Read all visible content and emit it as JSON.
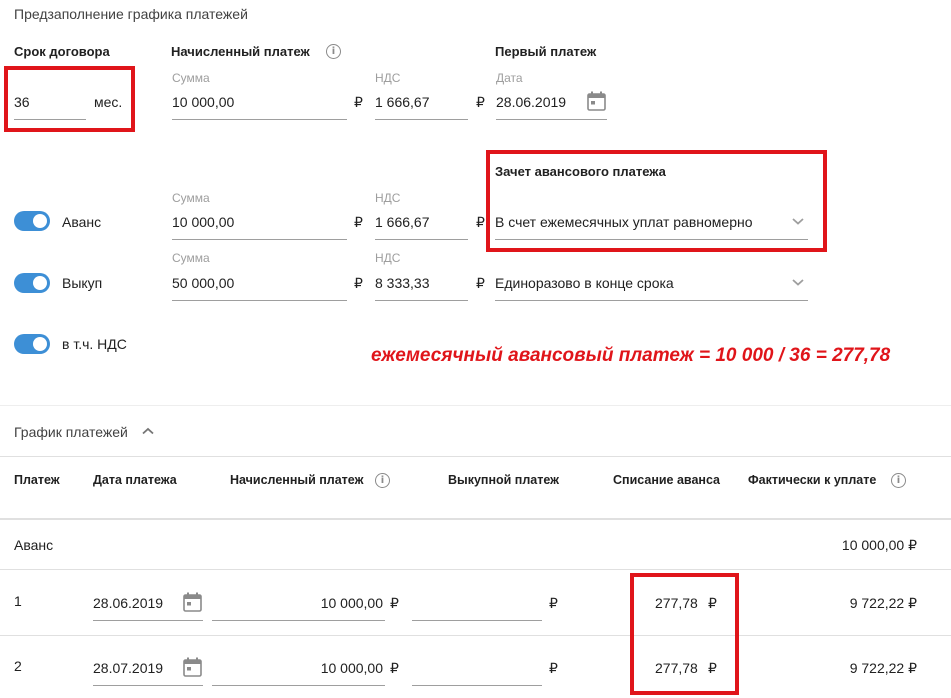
{
  "prefill": {
    "title": "Предзаполнение графика платежей",
    "term": {
      "label": "Срок договора",
      "value": "36",
      "unit": "мес."
    },
    "accrued": {
      "label": "Начисленный платеж",
      "sum_label": "Сумма",
      "sum_value": "10 000,00",
      "vat_label": "НДС",
      "vat_value": "1 666,67",
      "currency": "₽"
    },
    "first_payment": {
      "label": "Первый платеж",
      "date_label": "Дата",
      "date_value": "28.06.2019"
    },
    "advance": {
      "toggle_label": "Аванс",
      "sum_label": "Сумма",
      "sum_value": "10 000,00",
      "vat_label": "НДС",
      "vat_value": "1 666,67",
      "currency": "₽",
      "offset_label": "Зачет авансового платежа",
      "offset_value": "В счет ежемесячных уплат равномерно"
    },
    "buyout": {
      "toggle_label": "Выкуп",
      "sum_label": "Сумма",
      "sum_value": "50 000,00",
      "vat_label": "НДС",
      "vat_value": "8 333,33",
      "currency": "₽",
      "mode_value": "Единоразово в конце срока"
    },
    "vat_toggle_label": "в т.ч. НДС",
    "annotation": "ежемесячный авансовый платеж = 10 000 / 36 = 277,78"
  },
  "schedule": {
    "title": "График платежей",
    "columns": [
      "Платеж",
      "Дата платежа",
      "Начисленный платеж",
      "Выкупной платеж",
      "Списание аванса",
      "Фактически к уплате"
    ],
    "advance_row": {
      "label": "Аванс",
      "total": "10 000,00 ₽"
    },
    "rows": [
      {
        "num": "1",
        "date": "28.06.2019",
        "accrued": "10 000,00",
        "buyout": "",
        "advance_off": "277,78",
        "actual": "9 722,22 ₽"
      },
      {
        "num": "2",
        "date": "28.07.2019",
        "accrued": "10 000,00",
        "buyout": "",
        "advance_off": "277,78",
        "actual": "9 722,22 ₽"
      }
    ],
    "currency": "₽"
  },
  "colors": {
    "accent": "#3d8fd6",
    "highlight": "#e0151a",
    "annotation": "#e0151a"
  },
  "icons": [
    "info-icon",
    "calendar-icon",
    "chevron-down-icon",
    "chevron-up-icon"
  ]
}
